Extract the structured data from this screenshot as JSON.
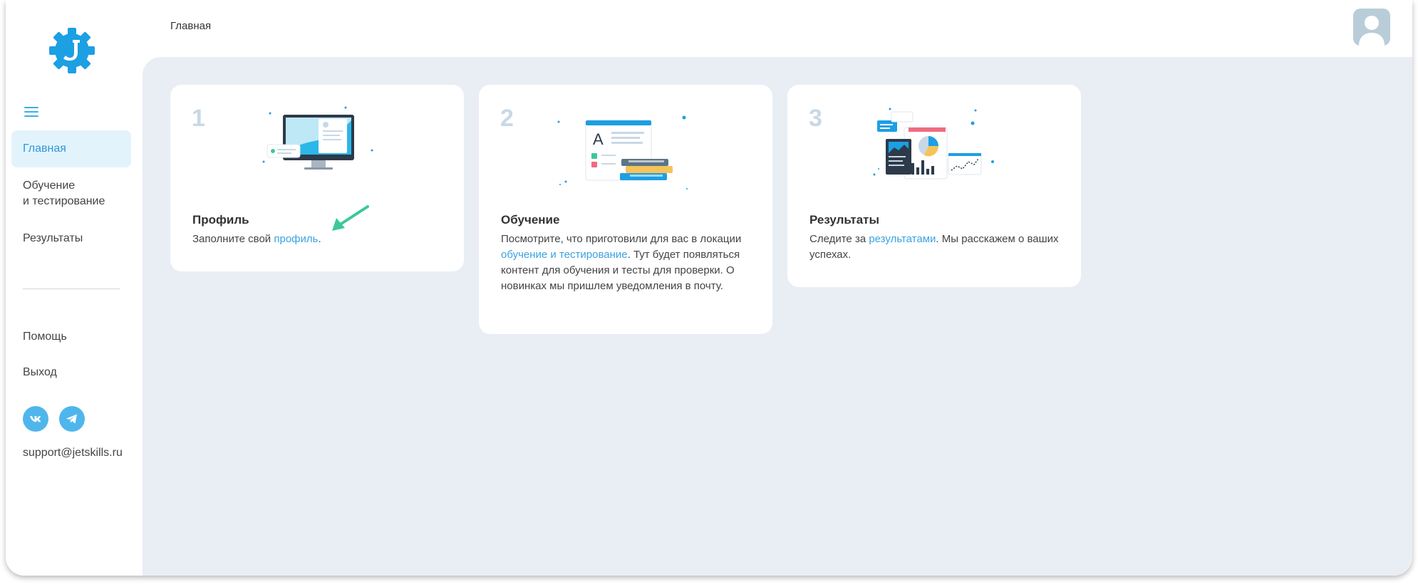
{
  "sidebar": {
    "items": [
      {
        "label_lines": [
          "Главная"
        ]
      },
      {
        "label_lines": [
          "Обучение",
          "и тестирование"
        ]
      },
      {
        "label_lines": [
          "Результаты"
        ]
      }
    ],
    "help": "Помощь",
    "logout": "Выход",
    "email": "support@jetskills.ru"
  },
  "header": {
    "breadcrumb": "Главная"
  },
  "cards": [
    {
      "number": "1",
      "title": "Профиль",
      "text_before": "Заполните свой ",
      "link": "профиль",
      "text_after": "."
    },
    {
      "number": "2",
      "title": "Обучение",
      "text_before": "Посмотрите, что приготовили для вас в локации ",
      "link": "обучение и тестирование",
      "text_after": ". Тут будет появляться контент для обучения и тесты для проверки. О новинках мы пришлем уведомления в почту."
    },
    {
      "number": "3",
      "title": "Результаты",
      "text_before": "Следите за ",
      "link": "результатами",
      "text_after": ". Мы расскажем о ваших успехах."
    }
  ],
  "colors": {
    "accent": "#3aaee6",
    "background": "#e9eef5",
    "arrow": "#3cc89a"
  }
}
